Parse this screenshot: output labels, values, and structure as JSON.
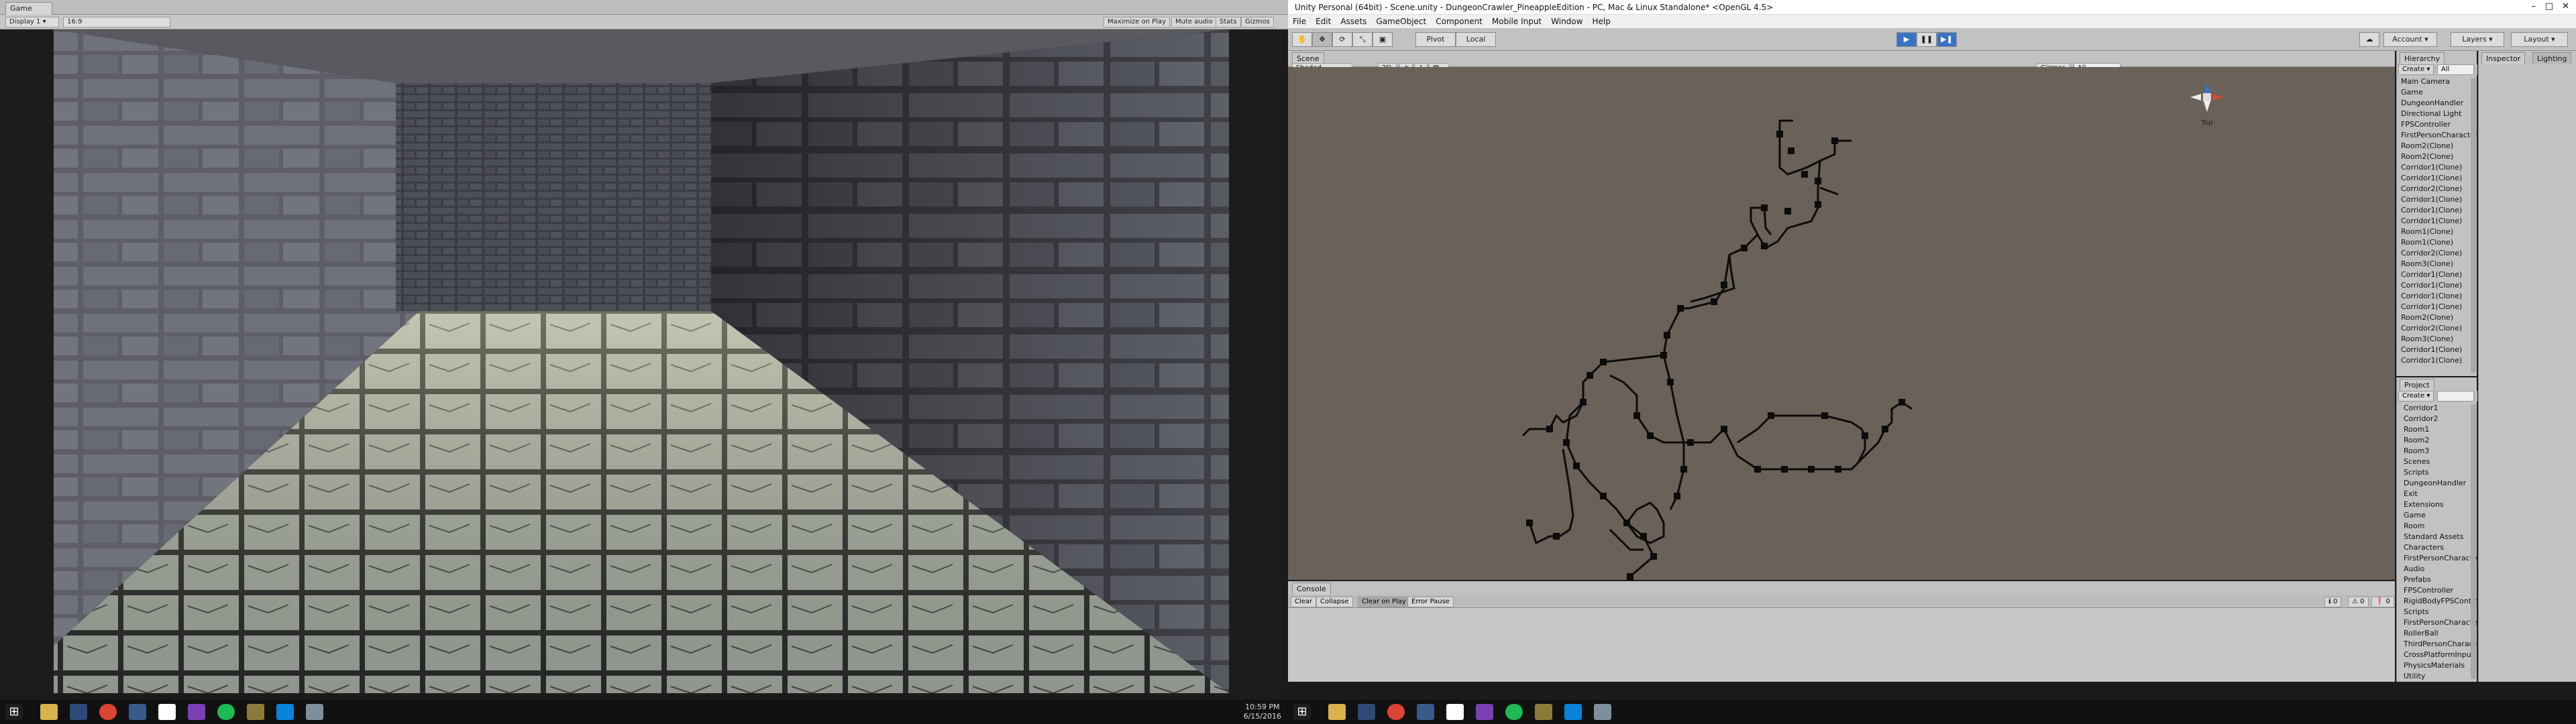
{
  "game_window": {
    "tab_label": "Game",
    "display_label": "Display 1",
    "aspect_label": "16:9",
    "buttons": [
      "Maximize on Play",
      "Mute audio",
      "Stats",
      "Gizmos"
    ]
  },
  "unity": {
    "title": "Unity Personal (64bit) - Scene.unity - DungeonCrawler_PineappleEdition - PC, Mac & Linux Standalone* <OpenGL 4.5>",
    "menu": [
      "File",
      "Edit",
      "Assets",
      "GameObject",
      "Component",
      "Mobile Input",
      "Window",
      "Help"
    ],
    "toolbar": {
      "pivot_label": "Pivot",
      "local_label": "Local",
      "account_label": "Account",
      "layers_label": "Layers",
      "layout_label": "Layout"
    },
    "scene": {
      "tab_label": "Scene",
      "shading_label": "Shaded",
      "mode_label": "2D",
      "gizmos_label": "Gizmos",
      "search_placeholder": "All",
      "orientation_label": "Top"
    },
    "console": {
      "tab_label": "Console",
      "buttons": [
        "Clear",
        "Collapse",
        "Clear on Play",
        "Error Pause"
      ],
      "counts": [
        "0",
        "0",
        "0"
      ]
    },
    "hierarchy": {
      "tab_label": "Hierarchy",
      "create_label": "Create",
      "search_placeholder": "All",
      "items": [
        "Main Camera",
        "Game",
        "DungeonHandler",
        "Directional Light",
        "FPSController",
        "FirstPersonCharacter",
        "Room2(Clone)",
        "Room2(Clone)",
        "Corridor1(Clone)",
        "Corridor1(Clone)",
        "Corridor2(Clone)",
        "Corridor1(Clone)",
        "Corridor1(Clone)",
        "Corridor1(Clone)",
        "Room1(Clone)",
        "Room1(Clone)",
        "Corridor2(Clone)",
        "Room3(Clone)",
        "Corridor1(Clone)",
        "Corridor1(Clone)",
        "Corridor1(Clone)",
        "Corridor1(Clone)",
        "Room2(Clone)",
        "Corridor2(Clone)",
        "Room3(Clone)",
        "Corridor1(Clone)",
        "Corridor1(Clone)"
      ]
    },
    "project": {
      "tab_label": "Project",
      "create_label": "Create",
      "items": [
        "Corridor1",
        "Corridor2",
        "Room1",
        "Room2",
        "Room3",
        "Scenes",
        "Scripts",
        "DungeonHandler",
        "Exit",
        "Extensions",
        "Game",
        "Room",
        "Standard Assets",
        "Characters",
        "FirstPersonCharacter",
        "Audio",
        "Prefabs",
        "FPSController",
        "RigidBodyFPSControlle",
        "Scripts",
        "FirstPersonCharacterGui",
        "RollerBall",
        "ThirdPersonCharacter",
        "CrossPlatformInput",
        "PhysicsMaterials",
        "Utility"
      ]
    },
    "inspector": {
      "tab_label": "Inspector",
      "lighting_label": "Lighting"
    }
  },
  "taskbar": {
    "time": "10:59 PM",
    "date": "6/15/2016"
  },
  "colors": {
    "scene_bg": "#6a6158",
    "editor_gray": "#c2c2c2",
    "taskbar": "#111111",
    "accent_blue": "#3a72c4"
  }
}
